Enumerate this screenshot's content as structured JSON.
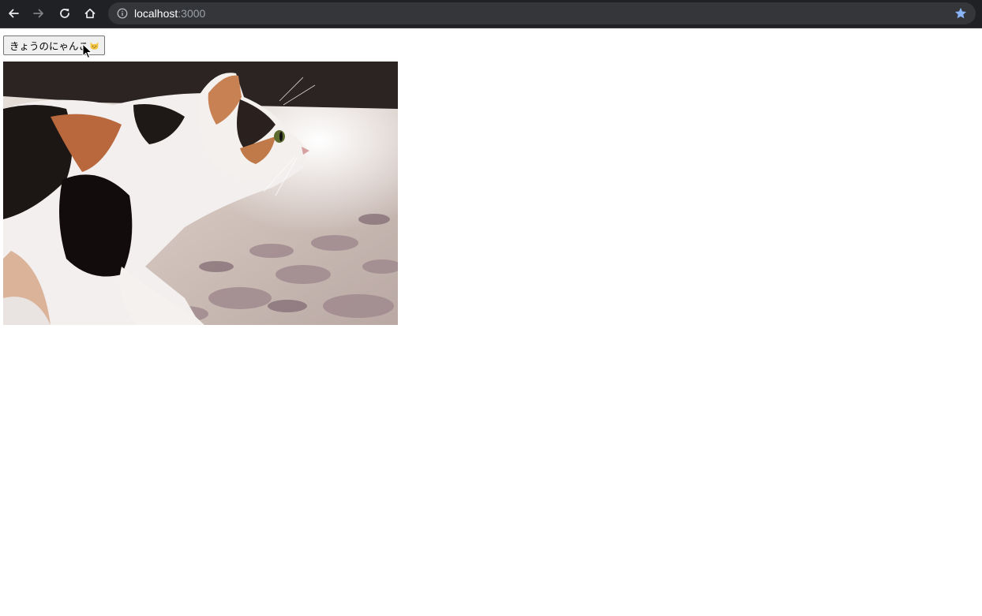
{
  "browser": {
    "url_host": "localhost",
    "url_port": ":3000",
    "icons": {
      "back": "arrow-left-icon",
      "forward": "arrow-right-icon",
      "reload": "reload-icon",
      "home": "home-icon",
      "site_info": "info-icon",
      "bookmark": "star-icon"
    },
    "colors": {
      "toolbar": "#202124",
      "omnibox": "#35363a",
      "star": "#8ab4f8"
    }
  },
  "page": {
    "button_label": "きょうのにゃんこ",
    "button_emoji": "cat-face-icon",
    "image": "calico-cat-photo"
  }
}
